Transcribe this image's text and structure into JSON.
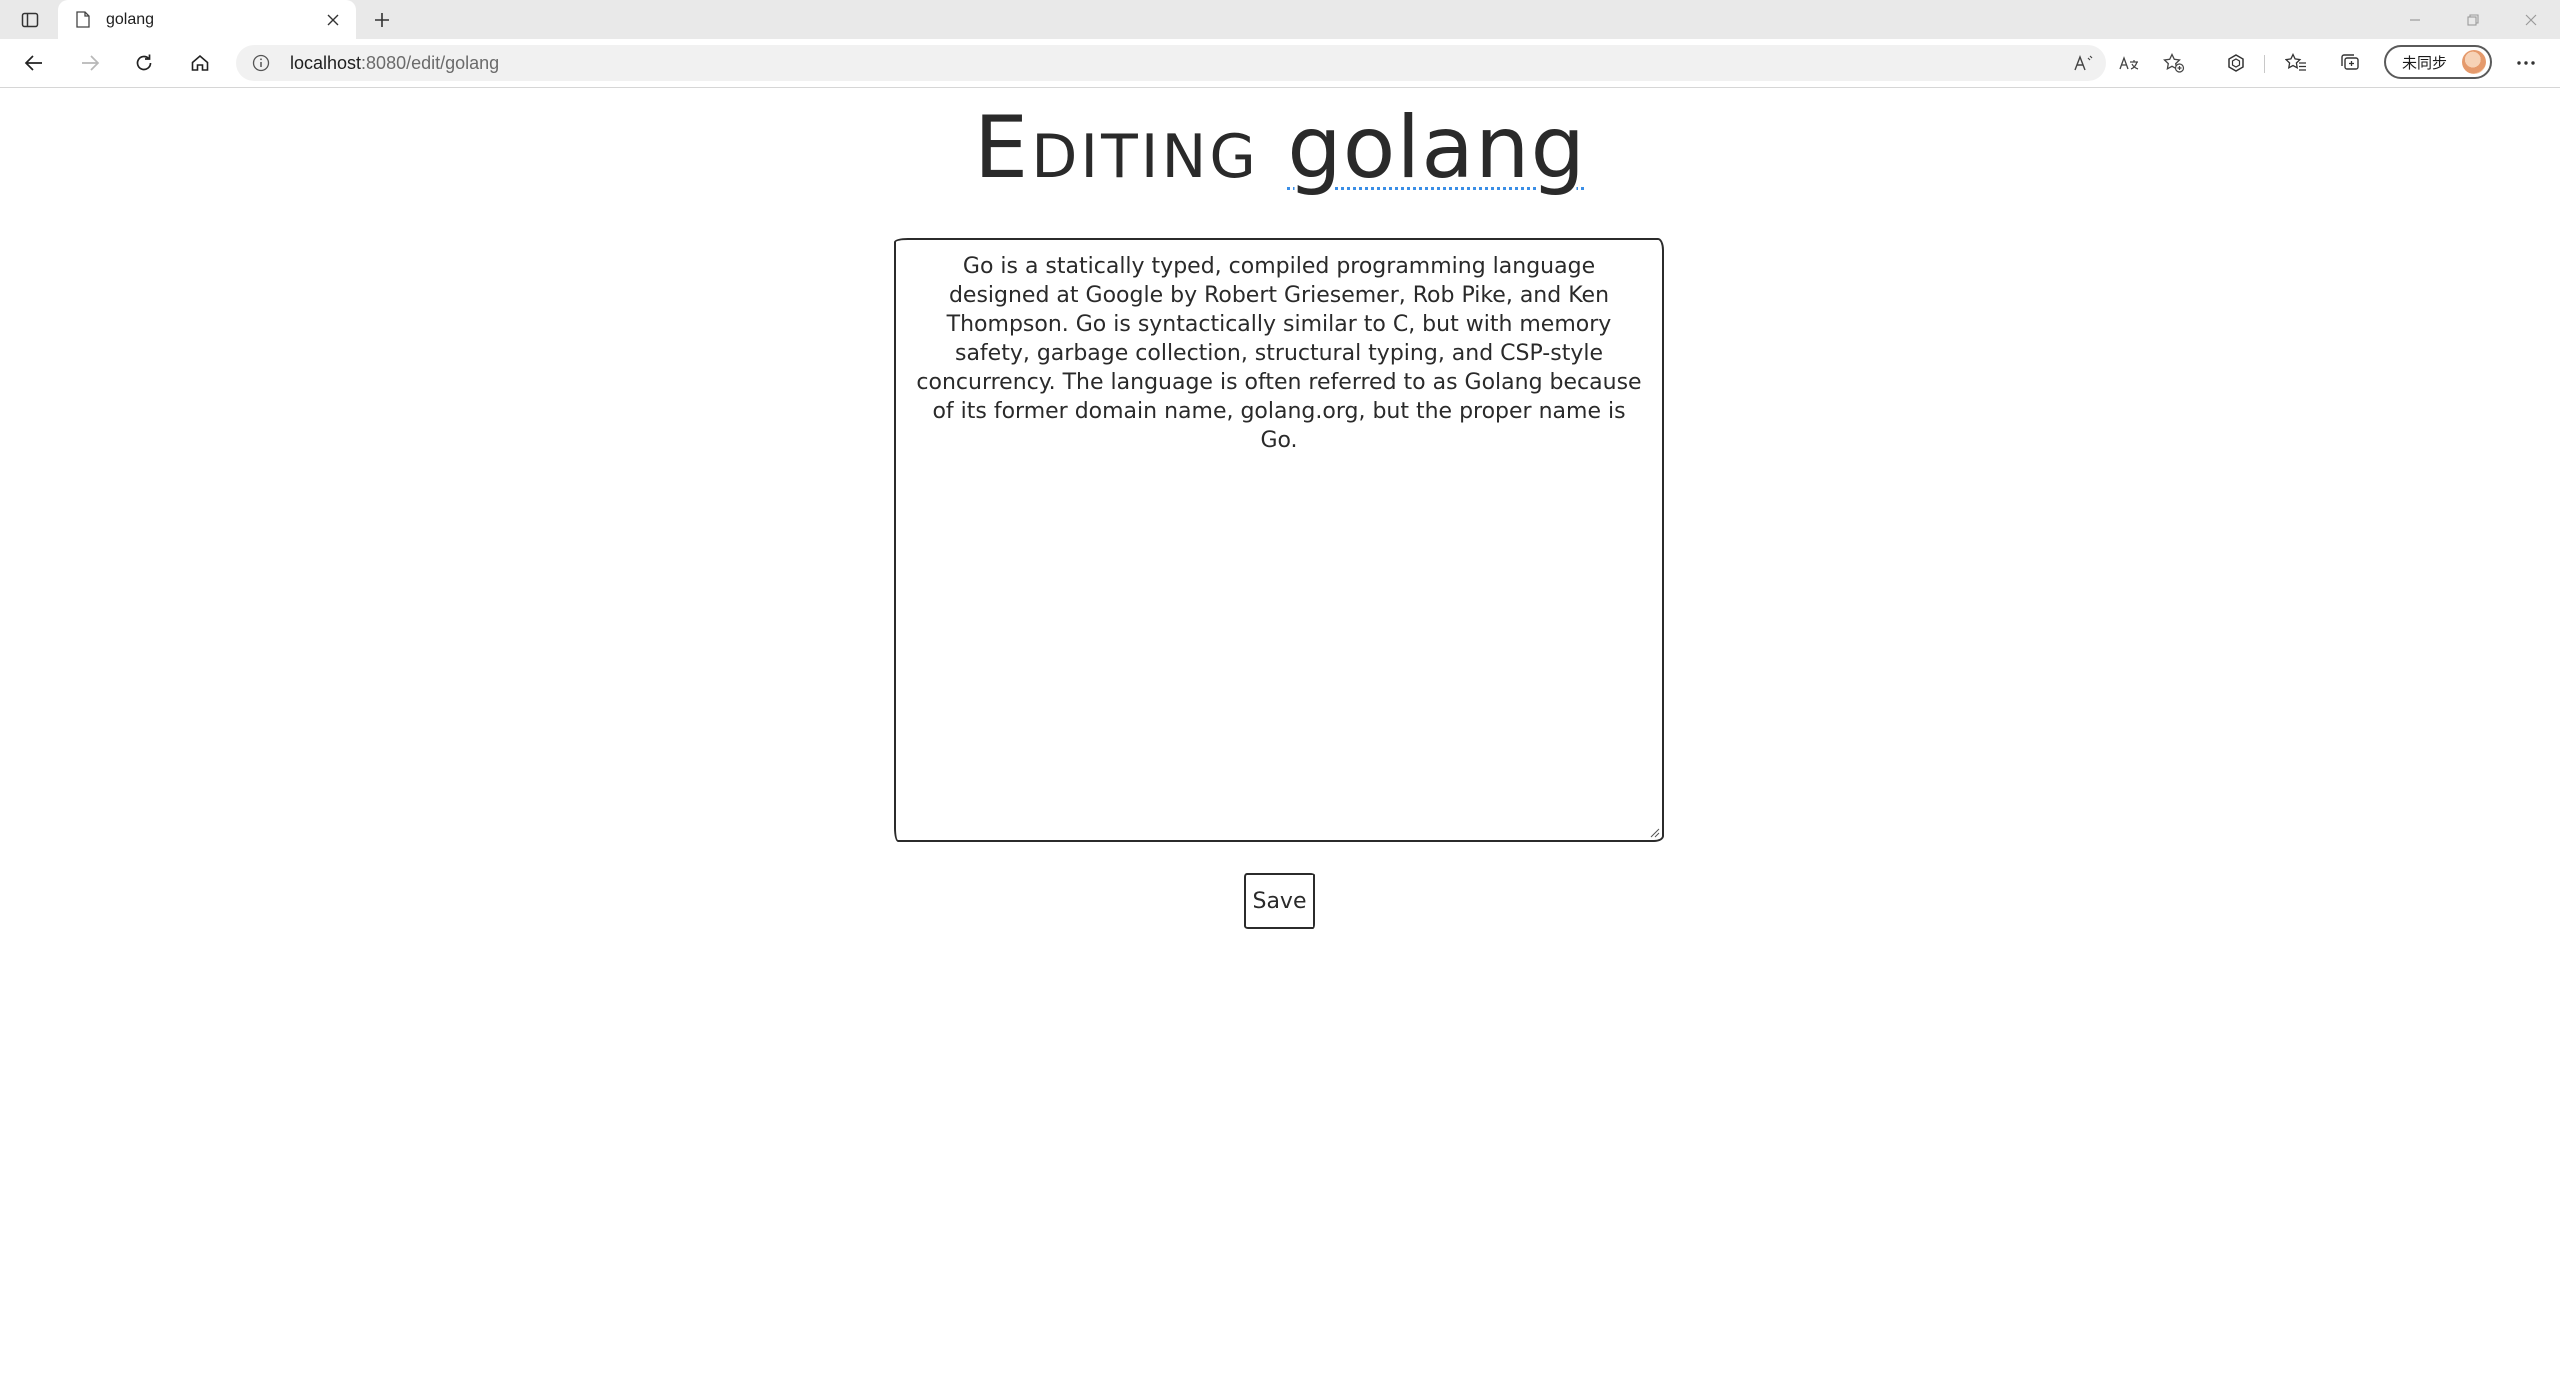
{
  "browser": {
    "tab": {
      "title": "golang"
    },
    "address": {
      "host": "localhost",
      "path": ":8080/edit/golang"
    },
    "profile": {
      "label": "未同步"
    },
    "icons": {
      "tab_actions": "tab-actions-icon",
      "page": "page-icon",
      "close": "close-icon",
      "new_tab": "plus-icon",
      "back": "back-arrow-icon",
      "forward": "forward-arrow-icon",
      "refresh": "refresh-icon",
      "home": "home-icon",
      "info": "info-icon",
      "read_aloud": "read-aloud-icon",
      "translate": "translate-icon",
      "add_favorite": "add-favorite-icon",
      "extensions": "extensions-icon",
      "favorites": "favorites-icon",
      "collections": "collections-icon",
      "more": "more-icon"
    }
  },
  "page": {
    "title_prefix": "Editing",
    "title_name": "golang",
    "body_text": "Go is a statically typed, compiled programming language designed at Google by Robert Griesemer, Rob Pike, and Ken Thompson. Go is syntactically similar to C, but with memory safety, garbage collection, structural typing, and CSP-style concurrency. The language is often referred to as Golang because of its former domain name, golang.org, but the proper name is Go.",
    "save_label": "Save"
  },
  "colors": {
    "tabstrip_bg": "#e9e9e9",
    "address_bg": "#f1f1f1",
    "text": "#2a2a2a",
    "spellcheck_underline": "#3a8ee6"
  }
}
